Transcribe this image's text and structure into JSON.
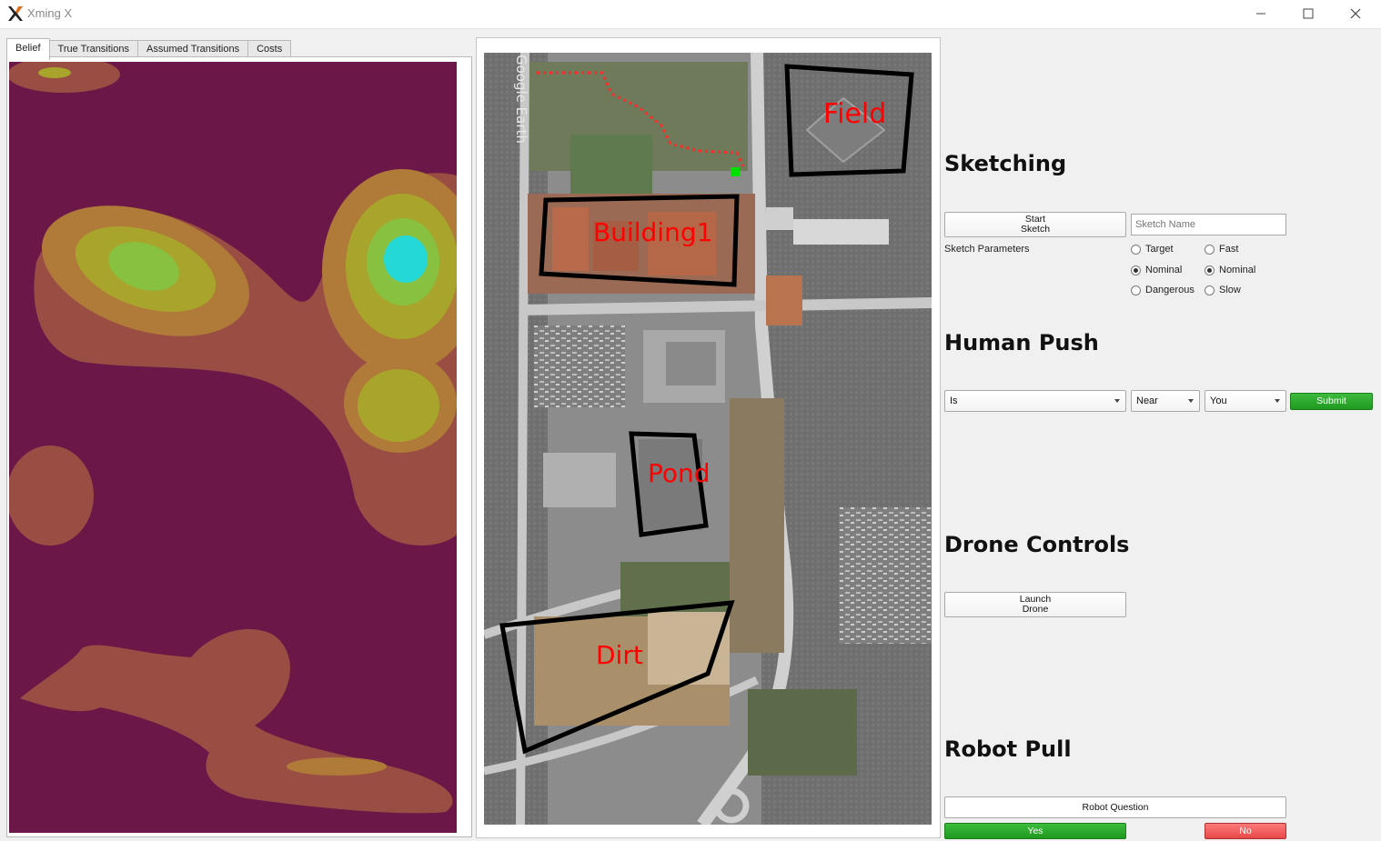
{
  "window": {
    "title": "Xming X",
    "logo_icon": "xming-x-logo-icon"
  },
  "tabs": [
    {
      "label": "Belief",
      "active": true
    },
    {
      "label": "True Transitions",
      "active": false
    },
    {
      "label": "Assumed Transitions",
      "active": false
    },
    {
      "label": "Costs",
      "active": false
    }
  ],
  "map": {
    "watermark": "Google Earth",
    "regions": [
      "Field",
      "Building1",
      "Pond",
      "Dirt"
    ],
    "region_color": "#ff0000",
    "outline_color": "#000000",
    "robot_color": "#00e000",
    "path_color": "#ff2a2a"
  },
  "sketching": {
    "title": "Sketching",
    "start_line1": "Start",
    "start_line2": "Sketch",
    "name_placeholder": "Sketch Name",
    "params_label": "Sketch Parameters",
    "col1": [
      {
        "label": "Target",
        "checked": false
      },
      {
        "label": "Nominal",
        "checked": true
      },
      {
        "label": "Dangerous",
        "checked": false
      }
    ],
    "col2": [
      {
        "label": "Fast",
        "checked": false
      },
      {
        "label": "Nominal",
        "checked": true
      },
      {
        "label": "Slow",
        "checked": false
      }
    ]
  },
  "human_push": {
    "title": "Human Push",
    "combo1": "Is",
    "combo2": "Near",
    "combo3": "You",
    "submit": "Submit"
  },
  "drone": {
    "title": "Drone Controls",
    "launch_line1": "Launch",
    "launch_line2": "Drone"
  },
  "robot_pull": {
    "title": "Robot Pull",
    "question": "Robot Question",
    "yes": "Yes",
    "no": "No"
  },
  "colors": {
    "belief_bg": "#6b1848",
    "belief_l1": "#9a4e43",
    "belief_l2": "#b07a38",
    "belief_l3": "#a9a52c",
    "belief_l4": "#88c040",
    "belief_l5": "#25d8d8",
    "accent_green": "#22a022",
    "accent_red": "#e84848"
  }
}
